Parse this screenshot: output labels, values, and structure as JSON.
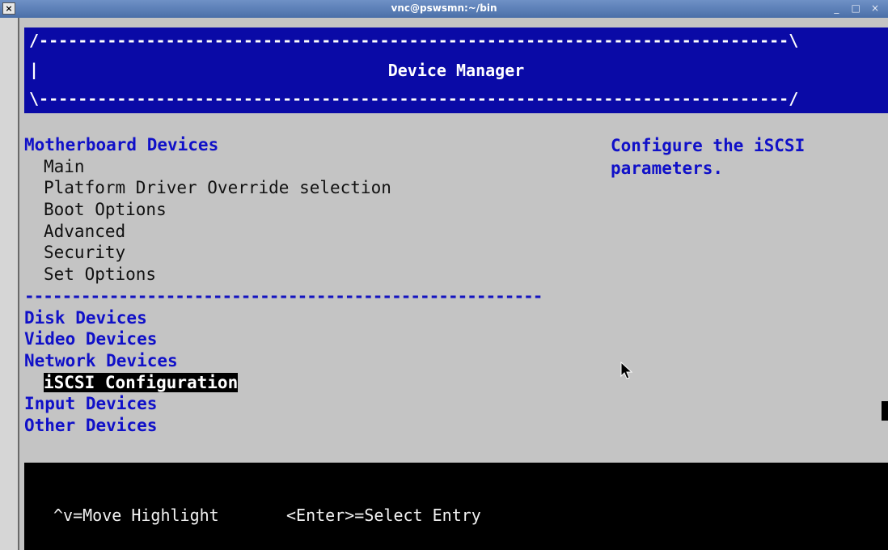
{
  "window": {
    "title": "vnc@pswsmn:~/bin",
    "menu_glyph": "×",
    "minimize": "_",
    "maximize": "□",
    "close": "×"
  },
  "header": {
    "border_top": "/-----------------------------------------------------------------------------\\",
    "border_mid": "|",
    "border_bottom": "\\-----------------------------------------------------------------------------/",
    "title": "Device Manager"
  },
  "menu": {
    "motherboard": {
      "label": "Motherboard Devices",
      "items": [
        "Main",
        "Platform Driver Override selection",
        "Boot Options",
        "Advanced",
        "Security",
        "Set Options"
      ]
    },
    "separator": "-------------------------------------------------------",
    "disk": "Disk Devices",
    "video": "Video Devices",
    "network": {
      "label": "Network Devices",
      "items": [
        "iSCSI Configuration"
      ]
    },
    "input": "Input Devices",
    "other": "Other Devices"
  },
  "help": {
    "line1": "Configure the iSCSI",
    "line2": "parameters."
  },
  "footer": {
    "move": "^v=Move Highlight",
    "select": "<Enter>=Select Entry"
  },
  "icons": {
    "mouse": "mouse-pointer-icon",
    "cursor": "text-cursor-block"
  }
}
